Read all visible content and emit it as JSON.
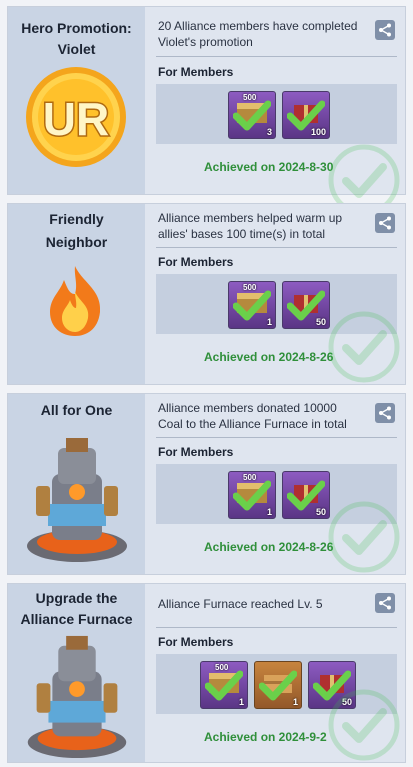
{
  "achievements": [
    {
      "title_line1": "Hero Promotion:",
      "title_line2": "Violet",
      "image_icon": "ur-badge-icon",
      "badge_text": "UR",
      "description_line1": "20 Alliance members have completed",
      "description_line2": "Violet's promotion",
      "for_members": "For Members",
      "rewards": [
        {
          "icon": "chest-icon",
          "caption": "500",
          "qty": "3",
          "color": "purple"
        },
        {
          "icon": "gift-box-icon",
          "caption": "",
          "qty": "100",
          "color": "purple"
        }
      ],
      "achieved": "Achieved on 2024-8-30"
    },
    {
      "title_line1": "Friendly",
      "title_line2": "Neighbor",
      "image_icon": "flame-icon",
      "description_line1": "Alliance members helped warm up",
      "description_line2": "allies' bases 100 time(s) in total",
      "for_members": "For Members",
      "rewards": [
        {
          "icon": "chest-icon",
          "caption": "500",
          "qty": "1",
          "color": "purple"
        },
        {
          "icon": "gift-box-icon",
          "caption": "",
          "qty": "50",
          "color": "purple"
        }
      ],
      "achieved": "Achieved on 2024-8-26"
    },
    {
      "title_line1": "All for One",
      "title_line2": "",
      "image_icon": "furnace-icon",
      "description_line1": "Alliance members donated 10000",
      "description_line2": "Coal to the Alliance Furnace in total",
      "for_members": "For Members",
      "rewards": [
        {
          "icon": "chest-icon",
          "caption": "500",
          "qty": "1",
          "color": "purple"
        },
        {
          "icon": "gift-box-icon",
          "caption": "",
          "qty": "50",
          "color": "purple"
        }
      ],
      "achieved": "Achieved on 2024-8-26"
    },
    {
      "title_line1": "Upgrade the",
      "title_line2": "Alliance Furnace",
      "image_icon": "furnace-icon",
      "description_line1": "Alliance Furnace reached Lv. 5",
      "description_line2": "",
      "for_members": "For Members",
      "rewards": [
        {
          "icon": "chest-icon",
          "caption": "500",
          "qty": "1",
          "color": "purple"
        },
        {
          "icon": "gold-crate-icon",
          "caption": "",
          "qty": "1",
          "color": "orange"
        },
        {
          "icon": "gift-box-icon",
          "caption": "",
          "qty": "50",
          "color": "purple"
        }
      ],
      "achieved": "Achieved on 2024-9-2"
    }
  ],
  "colors": {
    "achieved_text": "#2f8f3a",
    "card_bg": "#dfe5ef",
    "reward_purple": "#7a4aae",
    "reward_orange": "#b57434"
  }
}
